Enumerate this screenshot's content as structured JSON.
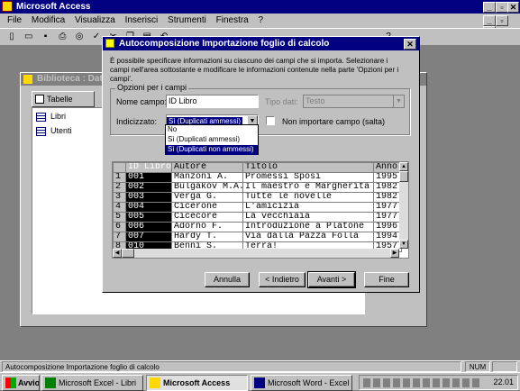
{
  "app": {
    "title": "Microsoft Access",
    "menu": [
      "File",
      "Modifica",
      "Visualizza",
      "Inserisci",
      "Strumenti",
      "Finestra",
      "?"
    ]
  },
  "db_window": {
    "title": "Biblioteca : Datab",
    "tab": "Tabelle",
    "items": [
      "Libri",
      "Utenti"
    ]
  },
  "dialog": {
    "title": "Autocomposizione Importazione foglio di calcolo",
    "description": "È possibile specificare informazioni su ciascuno dei campi che si importa. Selezionare i campi nell'area sottostante e modificare le informazioni contenute nella parte 'Opzioni per i campi'.",
    "group_label": "Opzioni per i campi",
    "field_name_label": "Nome campo:",
    "field_name_value": "ID Libro",
    "data_type_label": "Tipo dati:",
    "data_type_value": "Testo",
    "indexed_label": "Indicizzato:",
    "indexed_value": "Sì (Duplicati ammessi)",
    "indexed_options": [
      "No",
      "Sì (Duplicati ammessi)",
      "Sì (Duplicati non ammessi)"
    ],
    "skip_label": "Non importare campo (salta)",
    "table": {
      "headers": [
        "ID Libro",
        "Autore",
        "Titolo",
        "Anno"
      ],
      "rows": [
        [
          "1",
          "001",
          "Manzoni A.",
          "Promessi Sposi",
          "1995"
        ],
        [
          "2",
          "002",
          "Bulgakov M.A.",
          "Il maestro e Margherita",
          "1982"
        ],
        [
          "3",
          "003",
          "Verga G.",
          "Tutte le novelle",
          "1982"
        ],
        [
          "4",
          "004",
          "Cicerone",
          "L'amicizia",
          "1977"
        ],
        [
          "5",
          "005",
          "Cicecore",
          "La vecchiaia",
          "1977"
        ],
        [
          "6",
          "006",
          "Adorno F.",
          "Introduzione a Platone",
          "1996"
        ],
        [
          "7",
          "007",
          "Hardy T.",
          "Via dalla Pazza Folla",
          "1994"
        ],
        [
          "8",
          "010",
          "Benni S.",
          "Terra!",
          "1957"
        ]
      ]
    },
    "buttons": {
      "cancel": "Annulla",
      "back": "< Indietro",
      "next": "Avanti >",
      "finish": "Fine"
    }
  },
  "statusbar": {
    "text": "Autocomposizione Importazione foglio di calcolo",
    "num": "NUM"
  },
  "taskbar": {
    "start": "Avvio",
    "tasks": [
      "Microsoft Excel - Libri",
      "Microsoft Access",
      "Microsoft Word - Excel"
    ],
    "clock": "22.01"
  }
}
